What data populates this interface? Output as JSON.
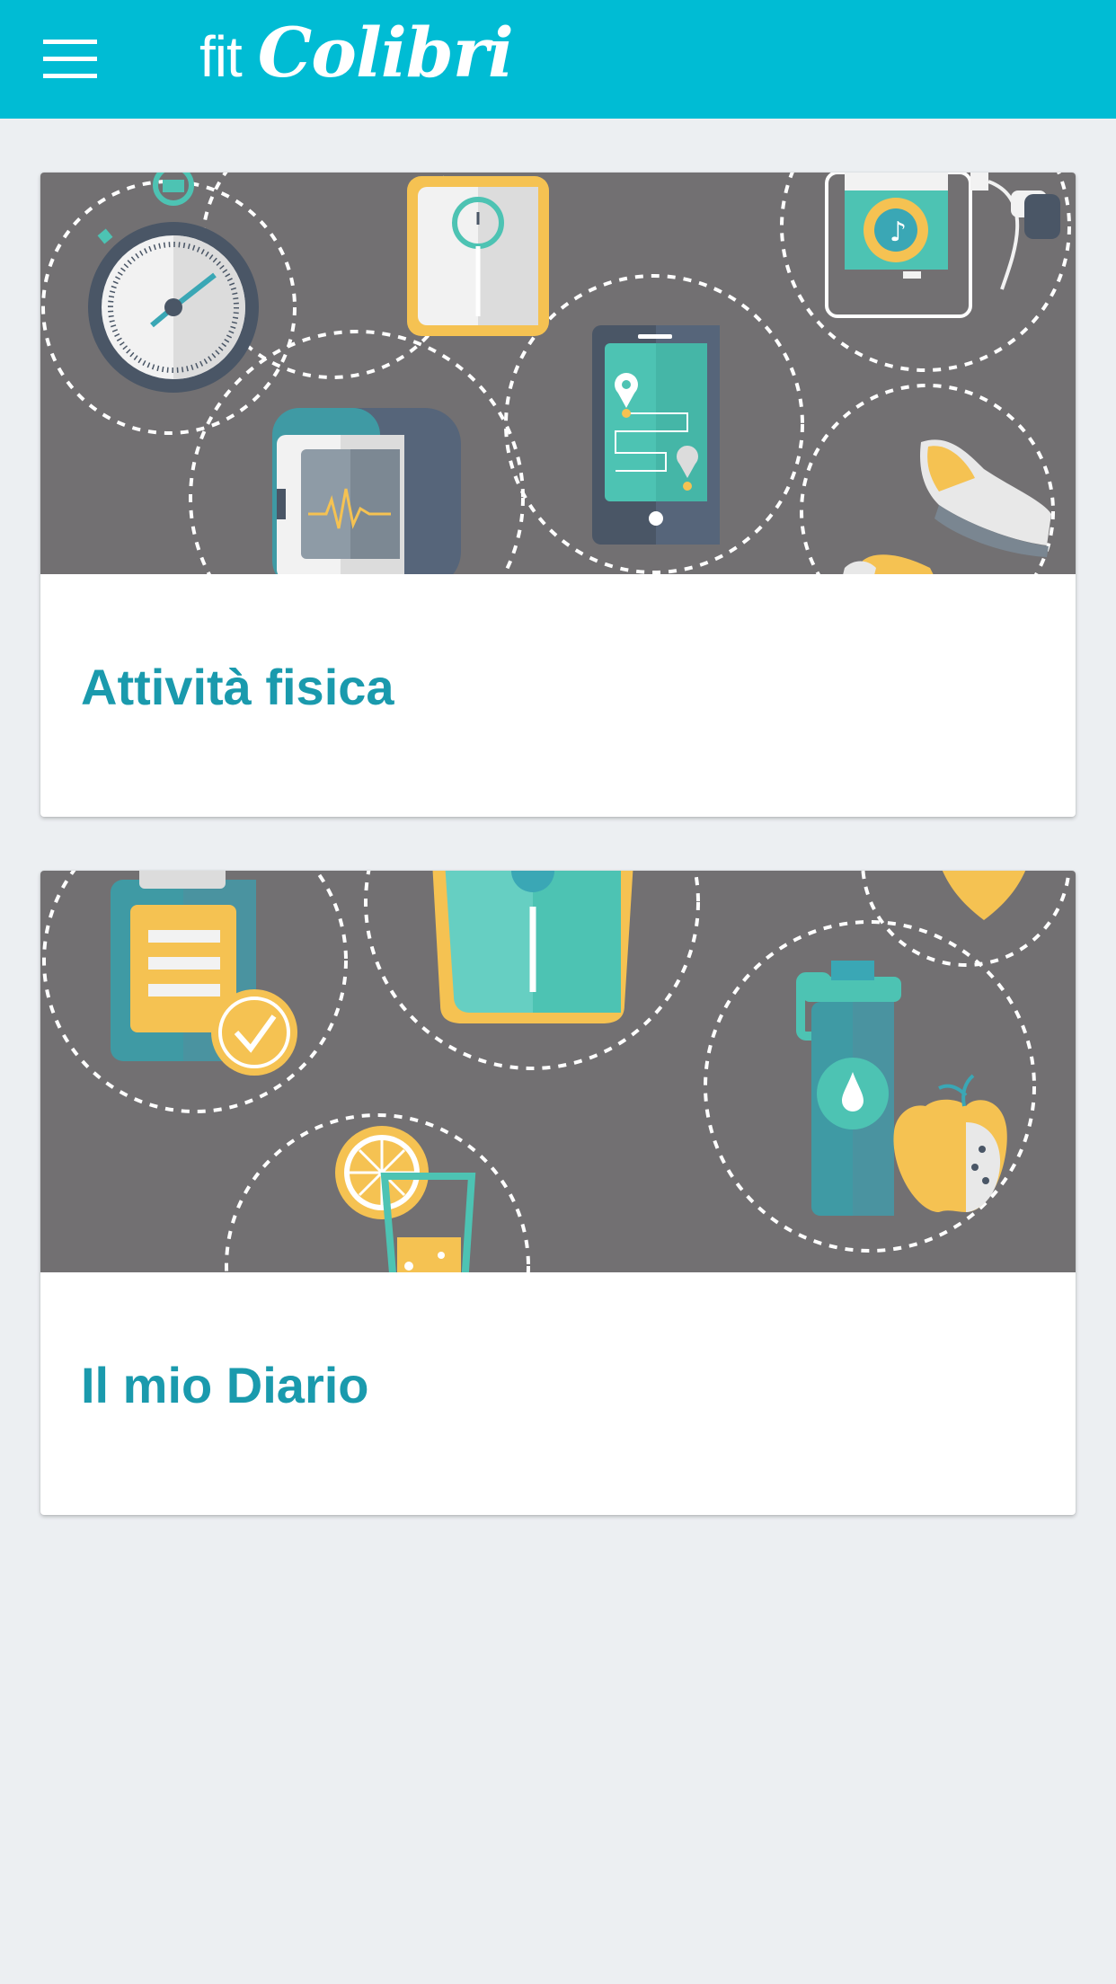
{
  "app": {
    "logo_prefix": "fit",
    "logo_name": "Colibri",
    "menu_icon": "hamburger-menu-icon"
  },
  "colors": {
    "appbar": "#00BCD4",
    "background": "#ECEFF2",
    "card_title": "#1A9AAD",
    "illustration_bg": "#727072",
    "teal": "#4DC3B3",
    "yellow": "#F5C252"
  },
  "cards": [
    {
      "title": "Attività fisica",
      "illustration": "fitness-gadgets-illustration",
      "icons": [
        "stopwatch-icon",
        "scale-icon",
        "smartwatch-icon",
        "smartphone-map-icon",
        "music-player-icon",
        "sneakers-icon"
      ]
    },
    {
      "title": "Il mio Diario",
      "illustration": "diary-nutrition-illustration",
      "icons": [
        "clipboard-check-icon",
        "scale-icon",
        "lemon-drink-icon",
        "water-bottle-icon",
        "apple-icon"
      ]
    }
  ]
}
